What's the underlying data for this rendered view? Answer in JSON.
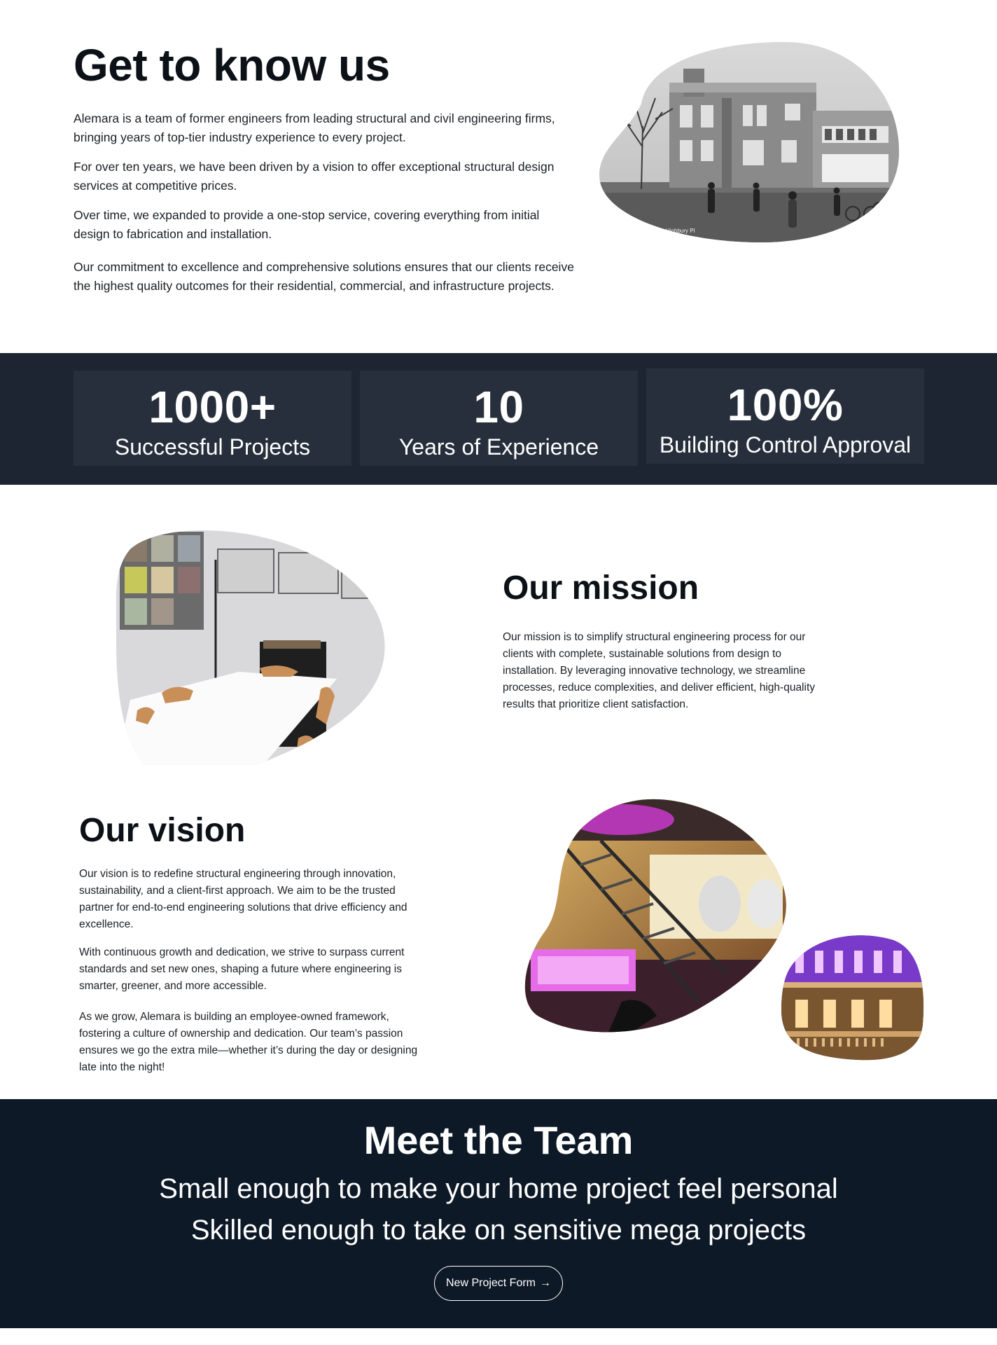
{
  "about": {
    "title": "Get to know us",
    "paragraphs": [
      "Alemara is a team of former engineers from leading structural and civil engineering firms, bringing years of top-tier industry experience to every project.",
      "For over ten years, we have been driven by a vision to offer exceptional structural design services at competitive prices.",
      "Over time, we expanded to provide a one-stop service, covering everything from initial design to fabrication and installation.",
      "Our commitment to excellence and comprehensive solutions ensures that our clients receive the highest quality outcomes for their residential, commercial, and infrastructure projects."
    ],
    "photo_sign": "Highbury Pl"
  },
  "stats": [
    {
      "value": "1000+",
      "label": "Successful Projects"
    },
    {
      "value": "10",
      "label": "Years of Experience"
    },
    {
      "value": "100%",
      "label": "Building Control Approval"
    }
  ],
  "mission": {
    "title": "Our mission",
    "text": "Our mission is to simplify structural engineering process for our clients with complete, sustainable solutions from design to installation. By leveraging innovative technology, we streamline processes, reduce complexities, and deliver efficient, high-quality results that prioritize client satisfaction."
  },
  "vision": {
    "title": "Our vision",
    "paragraphs": [
      "Our vision is to redefine structural engineering through innovation, sustainability, and a client-first approach. We aim to be the trusted partner for end-to-end engineering solutions that drive efficiency and excellence.",
      "With continuous growth and dedication, we strive to surpass current standards and set new ones, shaping a future where engineering is smarter, greener, and more accessible.",
      "As we grow, Alemara is building an employee-owned framework, fostering a culture of ownership and dedication. Our team’s passion ensures we go the extra mile—whether it’s during the day or designing late into the night!"
    ]
  },
  "team": {
    "title": "Meet the Team",
    "subtitle_1": "Small enough to make your home project feel personal",
    "subtitle_2": "Skilled enough to take on sensitive mega projects",
    "cta_label": "New Project Form",
    "cta_icon": "arrow-right-icon"
  },
  "colors": {
    "stats_band": "#1d2532",
    "stat_card": "#272f3c",
    "team_band": "#0e1928",
    "heading": "#0c1117"
  }
}
